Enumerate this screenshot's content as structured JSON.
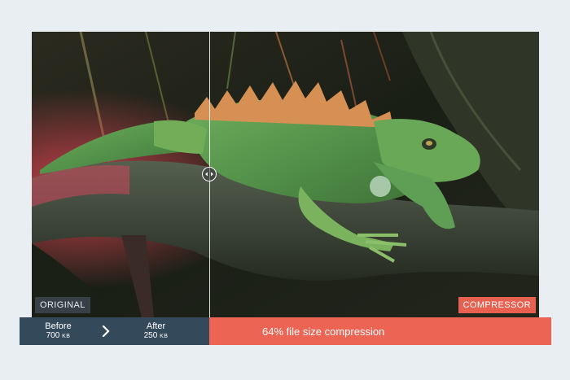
{
  "labels": {
    "original": "ORIGINAL",
    "compressor": "COMPRESSOR"
  },
  "stats": {
    "before_label": "Before",
    "before_value": "700",
    "before_unit": "KB",
    "after_label": "After",
    "after_value": "250",
    "after_unit": "KB"
  },
  "compression_message": "64% file size compression",
  "slider_position": 0.35,
  "colors": {
    "stats_panel": "#34495a",
    "accent": "#ec6454",
    "background": "#e9eef2"
  },
  "icons": {
    "slider_handle": "double-arrow-icon",
    "separator": "chevron-right-icon"
  }
}
